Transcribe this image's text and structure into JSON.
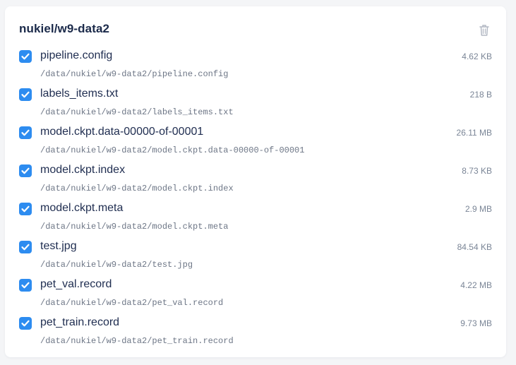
{
  "panel": {
    "title": "nukiel/w9-data2",
    "delete_icon": "trash-icon",
    "accent_color": "#2d8cf0"
  },
  "files": [
    {
      "name": "pipeline.config",
      "path": "/data/nukiel/w9-data2/pipeline.config",
      "size": "4.62 KB",
      "checked": true
    },
    {
      "name": "labels_items.txt",
      "path": "/data/nukiel/w9-data2/labels_items.txt",
      "size": "218 B",
      "checked": true
    },
    {
      "name": "model.ckpt.data-00000-of-00001",
      "path": "/data/nukiel/w9-data2/model.ckpt.data-00000-of-00001",
      "size": "26.11 MB",
      "checked": true
    },
    {
      "name": "model.ckpt.index",
      "path": "/data/nukiel/w9-data2/model.ckpt.index",
      "size": "8.73 KB",
      "checked": true
    },
    {
      "name": "model.ckpt.meta",
      "path": "/data/nukiel/w9-data2/model.ckpt.meta",
      "size": "2.9 MB",
      "checked": true
    },
    {
      "name": "test.jpg",
      "path": "/data/nukiel/w9-data2/test.jpg",
      "size": "84.54 KB",
      "checked": true
    },
    {
      "name": "pet_val.record",
      "path": "/data/nukiel/w9-data2/pet_val.record",
      "size": "4.22 MB",
      "checked": true
    },
    {
      "name": "pet_train.record",
      "path": "/data/nukiel/w9-data2/pet_train.record",
      "size": "9.73 MB",
      "checked": true
    }
  ]
}
